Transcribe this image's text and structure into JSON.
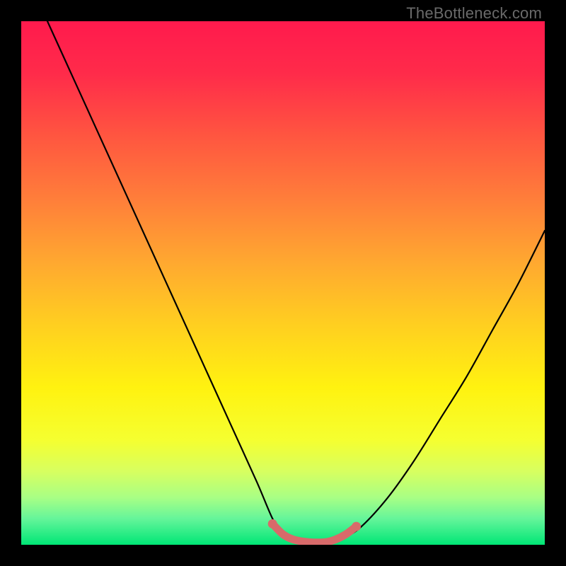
{
  "watermark": "TheBottleneck.com",
  "gradient": {
    "stops": [
      {
        "offset": 0.0,
        "color": "#ff1a4d"
      },
      {
        "offset": 0.1,
        "color": "#ff2b4a"
      },
      {
        "offset": 0.22,
        "color": "#ff5640"
      },
      {
        "offset": 0.34,
        "color": "#ff7e3a"
      },
      {
        "offset": 0.46,
        "color": "#ffa830"
      },
      {
        "offset": 0.58,
        "color": "#ffcf20"
      },
      {
        "offset": 0.7,
        "color": "#fff210"
      },
      {
        "offset": 0.8,
        "color": "#f5ff30"
      },
      {
        "offset": 0.86,
        "color": "#d7ff60"
      },
      {
        "offset": 0.91,
        "color": "#a8ff85"
      },
      {
        "offset": 0.95,
        "color": "#65f59a"
      },
      {
        "offset": 1.0,
        "color": "#00e676"
      }
    ]
  },
  "chart_data": {
    "type": "line",
    "title": "",
    "xlabel": "",
    "ylabel": "",
    "xlim": [
      0,
      100
    ],
    "ylim": [
      0,
      100
    ],
    "grid": false,
    "series": [
      {
        "name": "curve",
        "color": "#000000",
        "x": [
          5,
          10,
          15,
          20,
          25,
          30,
          35,
          40,
          45,
          48,
          50,
          52,
          55,
          58,
          60,
          62,
          65,
          70,
          75,
          80,
          85,
          90,
          95,
          100
        ],
        "y": [
          100,
          89,
          78,
          67,
          56,
          45,
          34,
          23,
          12,
          5,
          2,
          0.5,
          0,
          0,
          0.5,
          1.5,
          3.5,
          9,
          16,
          24,
          32,
          41,
          50,
          60
        ]
      },
      {
        "name": "trough-highlight",
        "color": "#d86a6a",
        "x": [
          48,
          50,
          52,
          55,
          58,
          60,
          62,
          64
        ],
        "y": [
          4,
          2,
          1,
          0.5,
          0.5,
          1,
          2,
          3.5
        ]
      }
    ]
  }
}
